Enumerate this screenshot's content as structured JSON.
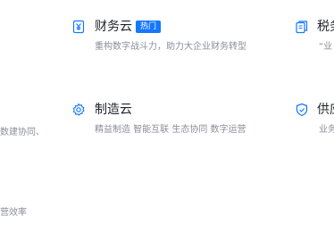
{
  "products": {
    "finance": {
      "title": "财务云",
      "badge": "热门",
      "description": "重构数字战斗力，助力大企业财务转型"
    },
    "tax": {
      "title": "税务",
      "description": "“业"
    },
    "manufacturing": {
      "title": "制造云",
      "description": "精益制造 智能互联 生态协同 数字运营"
    },
    "supply": {
      "title": "供应",
      "description": "业务"
    },
    "left_partial_1": {
      "description": "数建协同、"
    },
    "left_partial_2": {
      "description": "营效率"
    }
  },
  "colors": {
    "accent": "#1677ff",
    "title": "#1f2329",
    "description": "#8a8f99"
  },
  "icons": {
    "finance": "yen-document-icon",
    "tax": "copy-document-icon",
    "manufacturing": "gear-icon",
    "supply": "shield-icon"
  }
}
